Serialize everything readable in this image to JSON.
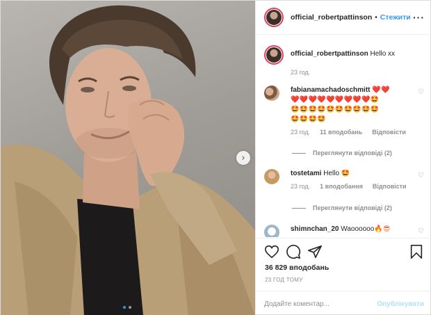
{
  "post": {
    "username": "official_robertpattinson",
    "separator": "•",
    "follow_label": "Стежити",
    "more_label": "···",
    "caption": "Hello xx",
    "caption_time": "23 год."
  },
  "comments": [
    {
      "user": "fabianamachadoschmitt",
      "emoji_line1": "❤️❤️",
      "emoji_line2": "❤️❤️❤️❤️❤️❤️❤️❤️❤️🤩",
      "emoji_line3": "🤩🤩🤩🤩🤩🤩🤩🤩🤩🤩",
      "emoji_line4": "🤩🤩🤩🤩",
      "time": "23 год.",
      "likes": "11 вподобань",
      "reply": "Відповісти",
      "view_replies": "Переглянути відповіді (2)"
    },
    {
      "user": "tostetami",
      "text": "Hello",
      "emoji": "🤩",
      "time": "23 год.",
      "likes": "1 вподобання",
      "reply": "Відповісти",
      "view_replies": "Переглянути відповіді (2)"
    },
    {
      "user": "shimnchan_20",
      "text": "Waoooooo",
      "emoji": "🔥😎"
    }
  ],
  "stats": {
    "likes": "36 829 вподобань",
    "timestamp": "23 ГОД ТОМУ"
  },
  "composer": {
    "placeholder": "Додайте коментар...",
    "post_label": "Опублікувати"
  },
  "carousel": {
    "next_icon": "chevron-right-icon",
    "slides": 2,
    "active": 1
  },
  "colors": {
    "follow": "#3897f0",
    "post_disabled": "#b2dffc",
    "story_ring": "#e0435b"
  }
}
